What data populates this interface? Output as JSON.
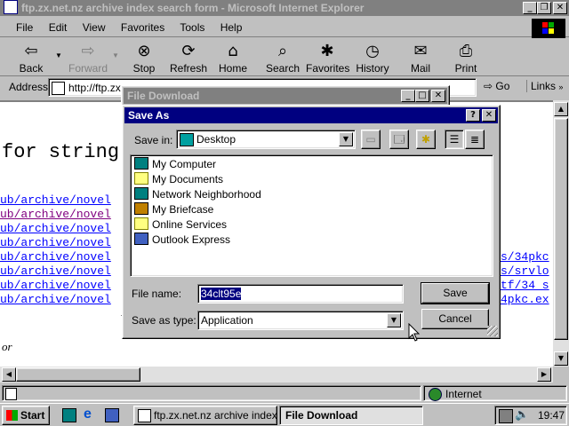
{
  "ie": {
    "title": "ftp.zx.net.nz archive index search form - Microsoft Internet Explorer",
    "menu": [
      "File",
      "Edit",
      "View",
      "Favorites",
      "Tools",
      "Help"
    ],
    "toolbar": {
      "back": "Back",
      "forward": "Forward",
      "stop": "Stop",
      "refresh": "Refresh",
      "home": "Home",
      "search": "Search",
      "favorites": "Favorites",
      "history": "History",
      "mail": "Mail",
      "print": "Print"
    },
    "address_label": "Address",
    "address_value": "http://ftp.zx",
    "go_label": "Go",
    "links_label": "Links",
    "status_zone": "Internet",
    "heading_fragment": "for string",
    "links_left": [
      "ub/archive/novel",
      "ub/archive/novel",
      "ub/archive/novel",
      "ub/archive/novel",
      "ub/archive/novel",
      "ub/archive/novel",
      "ub/archive/novel",
      "ub/archive/novel"
    ],
    "links_right": [
      "s/34pkc",
      "s/srvlo",
      "tf/34_s",
      "4pkc.ex"
    ],
    "footer_fragment": "or"
  },
  "file_download": {
    "title": "File Download"
  },
  "save_as": {
    "title": "Save As",
    "save_in_label": "Save in:",
    "save_in_value": "Desktop",
    "items": [
      "My Computer",
      "My Documents",
      "Network Neighborhood",
      "My Briefcase",
      "Online Services",
      "Outlook Express"
    ],
    "file_name_label": "File name:",
    "file_name_value": "34clt95e",
    "save_as_type_label": "Save as type:",
    "save_as_type_value": "Application",
    "save_button": "Save",
    "cancel_button": "Cancel"
  },
  "taskbar": {
    "start": "Start",
    "task1": "ftp.zx.net.nz archive index ...",
    "task2": "File Download",
    "clock": "19:47"
  }
}
